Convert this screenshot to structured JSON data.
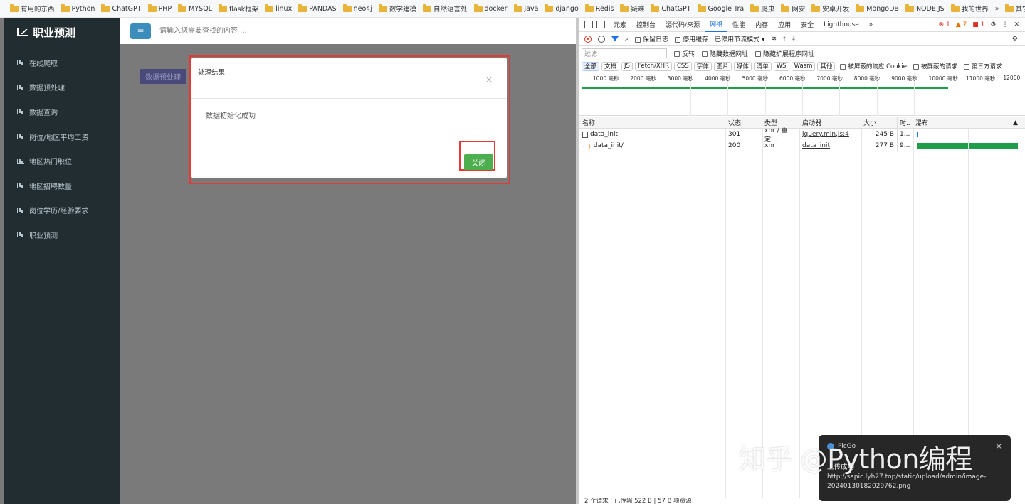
{
  "bookmarks": [
    "有用的东西",
    "Python",
    "ChatGPT",
    "PHP",
    "MYSQL",
    "flask框架",
    "linux",
    "PANDAS",
    "neo4j",
    "数学建模",
    "自然语言处",
    "docker",
    "java",
    "django",
    "Redis",
    "疑难",
    "ChatGPT",
    "Google Tra",
    "爬虫",
    "网安",
    "安卓开发",
    "MongoDB",
    "NODE.JS",
    "我的世界",
    "其它收藏"
  ],
  "bookmarks_overflow": "»",
  "app": {
    "brand": "职业预测",
    "nav": [
      "在线爬取",
      "数据预处理",
      "数据查询",
      "岗位/地区平均工资",
      "地区热门职位",
      "地区招聘数量",
      "岗位学历/经验要求",
      "职业预测"
    ],
    "menu_icon": "≡",
    "search_placeholder": "请输入您需要查找的内容 ...",
    "preprocess_button": "数据预处理"
  },
  "modal": {
    "title": "处理结果",
    "close_x": "×",
    "message": "数据初始化成功",
    "close_button": "关闭"
  },
  "devtools": {
    "tabs": [
      "元素",
      "控制台",
      "源代码/来源",
      "网络",
      "性能",
      "内存",
      "应用",
      "安全",
      "Lighthouse"
    ],
    "active_tab": "网络",
    "more": "»",
    "errors": "1",
    "warnings": "7",
    "issues": "1",
    "toolbar": {
      "preserve_log": "保留日志",
      "disable_cache": "停用缓存",
      "throttle": "已停用节流模式"
    },
    "filter": {
      "placeholder": "过滤",
      "invert": "反转",
      "hide_data_urls": "隐藏数据网址",
      "hide_ext_urls": "隐藏扩展程序网址"
    },
    "types": [
      "全部",
      "文档",
      "JS",
      "Fetch/XHR",
      "CSS",
      "字体",
      "图片",
      "媒体",
      "清单",
      "WS",
      "Wasm",
      "其他"
    ],
    "blocked_cookies": "被屏蔽的响应 Cookie",
    "blocked_requests": "被屏蔽的请求",
    "third_party": "第三方请求",
    "timeline_ticks": [
      "1000 毫秒",
      "2000 毫秒",
      "3000 毫秒",
      "4000 毫秒",
      "5000 毫秒",
      "6000 毫秒",
      "7000 毫秒",
      "8000 毫秒",
      "9000 毫秒",
      "10000 毫秒",
      "11000 毫秒",
      "12000"
    ],
    "columns": [
      "名称",
      "状态",
      "类型",
      "启动器",
      "大小",
      "时..",
      "瀑布"
    ],
    "rows": [
      {
        "name": "data_init",
        "status": "301",
        "type": "xhr / 重定...",
        "initiator": "jquery.min.js:4",
        "size": "245 B",
        "time": "1..."
      },
      {
        "name": "data_init/",
        "status": "200",
        "type": "xhr",
        "initiator": "data_init",
        "size": "277 B",
        "time": "9..."
      }
    ],
    "status_bar": "2 个请求 | 已传输 522 B | 57 B 项资源"
  },
  "toast": {
    "app": "PicGo",
    "message": "上传成功",
    "url": "http://sapic.lyh27.top/static/upload/admin/image-20240130182029762.png",
    "close": "×"
  },
  "watermark": "知乎 @Python编程"
}
